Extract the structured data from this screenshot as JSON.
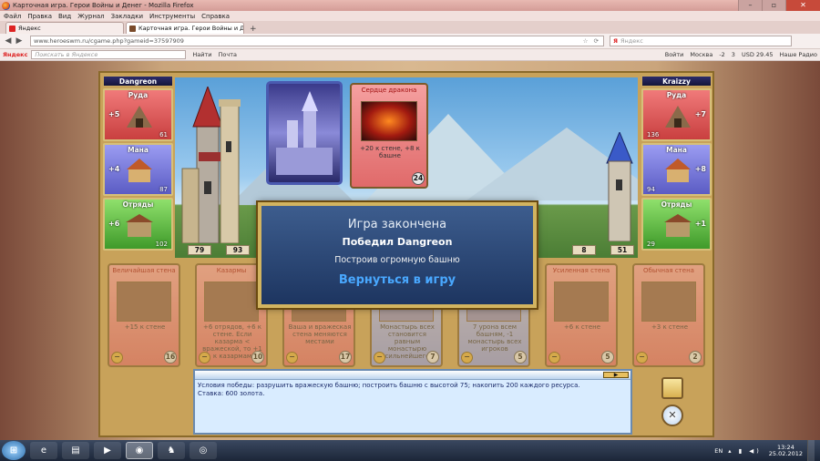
{
  "window": {
    "title": "Карточная игра. Герои Войны и Денег - Mozilla Firefox"
  },
  "menu": [
    "Файл",
    "Правка",
    "Вид",
    "Журнал",
    "Закладки",
    "Инструменты",
    "Справка"
  ],
  "tabs": [
    {
      "label": "Яндекс",
      "active": false
    },
    {
      "label": "Карточная игра. Герои Войны и Де...",
      "active": true
    }
  ],
  "nav": {
    "url": "www.heroeswm.ru/cgame.php?gameid=37597909",
    "search_placeholder": "Яндекс",
    "search_logo": "Я"
  },
  "yandex_bar": {
    "logo": "Яндекс",
    "search_placeholder": "Поискать в Яндексе",
    "find": "Найти",
    "mail": "Почта",
    "login": "Войти",
    "city": "Москва",
    "weather": "-2",
    "mail_count": "3",
    "currency": "USD 29.45",
    "radio": "Наше Радио"
  },
  "game": {
    "left_player": {
      "name": "Dangreon",
      "ore": {
        "label": "Руда",
        "income": "+5",
        "amount": "61"
      },
      "mana": {
        "label": "Мана",
        "income": "+4",
        "amount": "87"
      },
      "troops": {
        "label": "Отряды",
        "income": "+6",
        "amount": "102"
      },
      "tower": "79",
      "wall": "93"
    },
    "right_player": {
      "name": "Kraizzy",
      "ore": {
        "label": "Руда",
        "income": "+7",
        "amount": "136"
      },
      "mana": {
        "label": "Мана",
        "income": "+8",
        "amount": "94"
      },
      "troops": {
        "label": "Отряды",
        "income": "+1",
        "amount": "29"
      },
      "tower": "51",
      "wall": "8"
    },
    "played_card": {
      "title": "Сердце дракона",
      "desc": "+20 к стене, +8 к башне",
      "cost": "24"
    },
    "hand": [
      {
        "title": "Величайшая стена",
        "desc": "+15 к стене",
        "cost": "16",
        "color": "red"
      },
      {
        "title": "Казармы",
        "desc": "+6 отрядов, +6 к стене. Если казарма < вражеской, то +1 к казармам",
        "cost": "10",
        "color": "red"
      },
      {
        "title": "",
        "desc": "Ваша и вражеская стена меняются местами",
        "cost": "17",
        "color": "red"
      },
      {
        "title": "",
        "desc": "Монастырь всех становится равным монастырю сильнейшего",
        "cost": "7",
        "color": "blue"
      },
      {
        "title": "",
        "desc": "7 урона всем башням, -1 монастырь всех игроков",
        "cost": "5",
        "color": "blue"
      },
      {
        "title": "Усиленная стена",
        "desc": "+6 к стене",
        "cost": "5",
        "color": "red"
      },
      {
        "title": "Обычная стена",
        "desc": "+3 к стене",
        "cost": "2",
        "color": "red"
      }
    ],
    "minus": "−",
    "log_lines": [
      "Условия победы: разрушить вражескую башню; построить башню с высотой 75; накопить 200 каждого ресурса.",
      "Ставка: 600 золота."
    ],
    "dialog": {
      "title": "Игра закончена",
      "winner": "Победил Dangreon",
      "reason": "Построив огромную башню",
      "back": "Вернуться в игру"
    }
  },
  "taskbar": {
    "lang": "EN",
    "time": "13:24",
    "date": "25.02.2012"
  },
  "colors": {
    "ore": "#c93f3f",
    "mana": "#5b5cc4",
    "troops": "#3f9a2a",
    "dialog": "#1d3560",
    "link": "#49a8ff"
  }
}
